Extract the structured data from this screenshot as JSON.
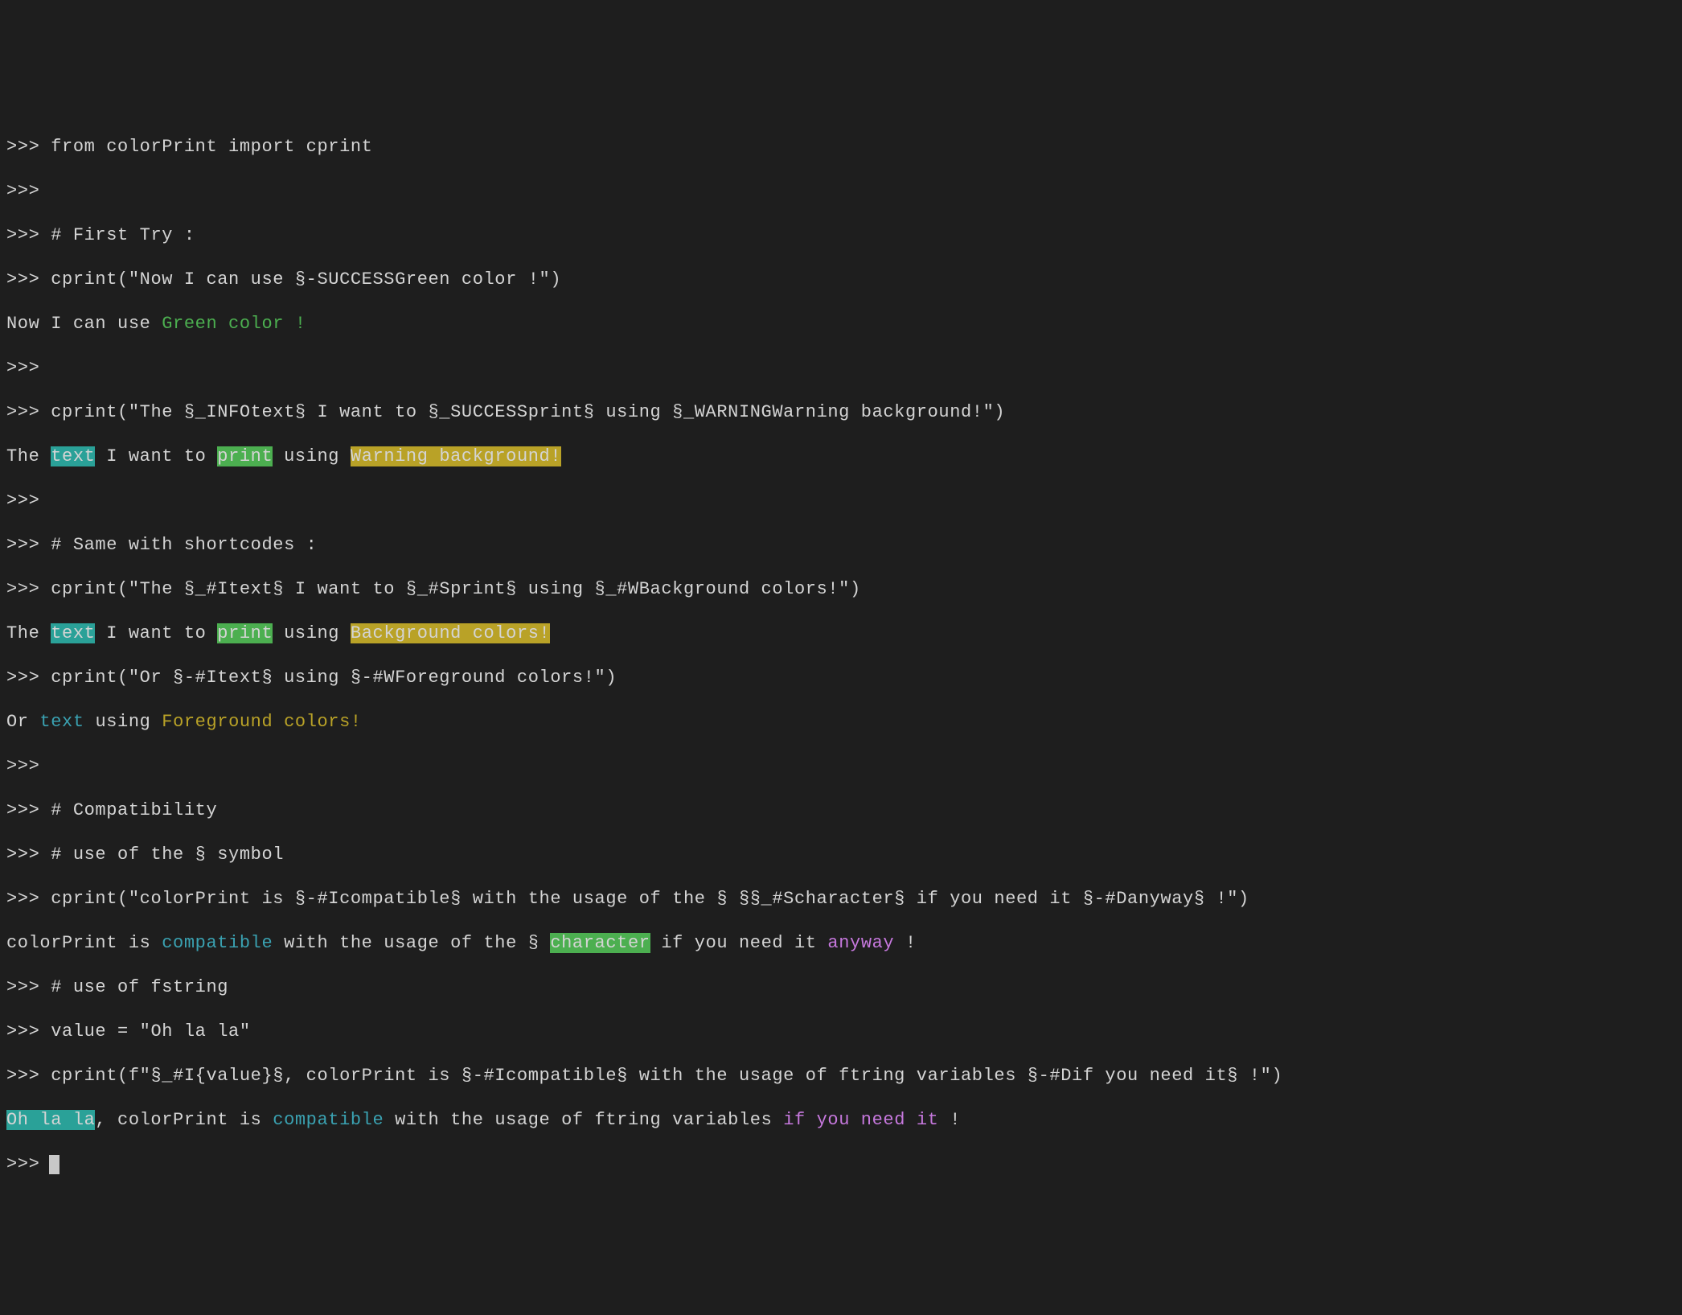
{
  "prompt": ">>> ",
  "empty_prompt": ">>>",
  "lines": {
    "l01": "from colorPrint import cprint",
    "l02": "# First Try :",
    "l03": "cprint(\"Now I can use §-SUCCESSGreen color !\")",
    "out03_a": "Now I can use ",
    "out03_b": "Green color !",
    "l04": "cprint(\"The §_INFOtext§ I want to §_SUCCESSprint§ using §_WARNINGWarning background!\")",
    "out04_a": "The ",
    "out04_b": "text",
    "out04_c": " I want to ",
    "out04_d": "print",
    "out04_e": " using ",
    "out04_f": "Warning background!",
    "l05": "# Same with shortcodes :",
    "l06": "cprint(\"The §_#Itext§ I want to §_#Sprint§ using §_#WBackground colors!\")",
    "out06_a": "The ",
    "out06_b": "text",
    "out06_c": " I want to ",
    "out06_d": "print",
    "out06_e": " using ",
    "out06_f": "Background colors!",
    "l07": "cprint(\"Or §-#Itext§ using §-#WForeground colors!\")",
    "out07_a": "Or ",
    "out07_b": "text",
    "out07_c": " using ",
    "out07_d": "Foreground colors!",
    "l08": "# Compatibility",
    "l09": "# use of the § symbol",
    "l10": "cprint(\"colorPrint is §-#Icompatible§ with the usage of the § §§_#Scharacter§ if you need it §-#Danyway§ !\")",
    "out10_a": "colorPrint is ",
    "out10_b": "compatible",
    "out10_c": " with the usage of the § ",
    "out10_d": "character",
    "out10_e": " if you need it ",
    "out10_f": "anyway",
    "out10_g": " !",
    "l11": "# use of fstring",
    "l12": "value = \"Oh la la\"",
    "l13": "cprint(f\"§_#I{value}§, colorPrint is §-#Icompatible§ with the usage of ftring variables §-#Dif you need it§ !\")",
    "out13_a": "Oh la la",
    "out13_b": ", colorPrint is ",
    "out13_c": "compatible",
    "out13_d": " with the usage of ftring variables ",
    "out13_e": "if you need it",
    "out13_f": " !"
  },
  "colors": {
    "bg": "#1e1e1e",
    "fg_default": "#d4d4d4",
    "fg_green": "#4caf50",
    "fg_info": "#3aa1b1",
    "fg_warn": "#b9a227",
    "fg_danger": "#c678dd",
    "bg_info": "#2aa198",
    "bg_success": "#4caf50",
    "bg_warn": "#b9a227"
  }
}
